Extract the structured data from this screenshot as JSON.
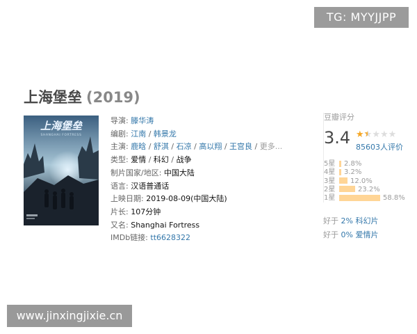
{
  "badge": {
    "text": "TG: MYYJJPP"
  },
  "movie": {
    "title": "上海堡垒",
    "year": "(2019)"
  },
  "poster": {
    "title_art": "上海堡垒",
    "subtitle_art": "SHANGHAI FORTRESS"
  },
  "info": {
    "director_label": "导演:",
    "director": "滕华涛",
    "writer_label": "编剧:",
    "writers": [
      "江南",
      "韩景龙"
    ],
    "cast_label": "主演:",
    "cast": [
      "鹿晗",
      "舒淇",
      "石凉",
      "高以翔",
      "王宫良"
    ],
    "cast_more": "更多...",
    "genre_label": "类型:",
    "genres": [
      "爱情",
      "科幻",
      "战争"
    ],
    "region_label": "制片国家/地区:",
    "region": "中国大陆",
    "language_label": "语言:",
    "language": "汉语普通话",
    "release_label": "上映日期:",
    "release": "2019-08-09(中国大陆)",
    "runtime_label": "片长:",
    "runtime": "107分钟",
    "aka_label": "又名:",
    "aka": "Shanghai Fortress",
    "imdb_label": "IMDb链接:",
    "imdb": "tt6628322",
    "separator": " / "
  },
  "rating": {
    "title": "豆瓣评分",
    "score": "3.4",
    "stars_value": 1.5,
    "star_color": "#f5a623",
    "votes": "85603人评价",
    "bars": [
      {
        "label": "5星",
        "pct": "2.8%",
        "fraction": 0.028
      },
      {
        "label": "4星",
        "pct": "3.2%",
        "fraction": 0.032
      },
      {
        "label": "3星",
        "pct": "12.0%",
        "fraction": 0.12
      },
      {
        "label": "2星",
        "pct": "23.2%",
        "fraction": 0.232
      },
      {
        "label": "1星",
        "pct": "58.8%",
        "fraction": 0.588
      }
    ],
    "bar_color": "#ffd596"
  },
  "better_than": [
    {
      "prefix": "好于",
      "value": "2% 科幻片"
    },
    {
      "prefix": "好于",
      "value": "0% 爱情片"
    }
  ],
  "watermark": {
    "text": "www.jinxingjixie.cn"
  },
  "colors": {
    "link": "#3377aa",
    "title": "#494949",
    "badge_bg": "#9b9b9b"
  }
}
